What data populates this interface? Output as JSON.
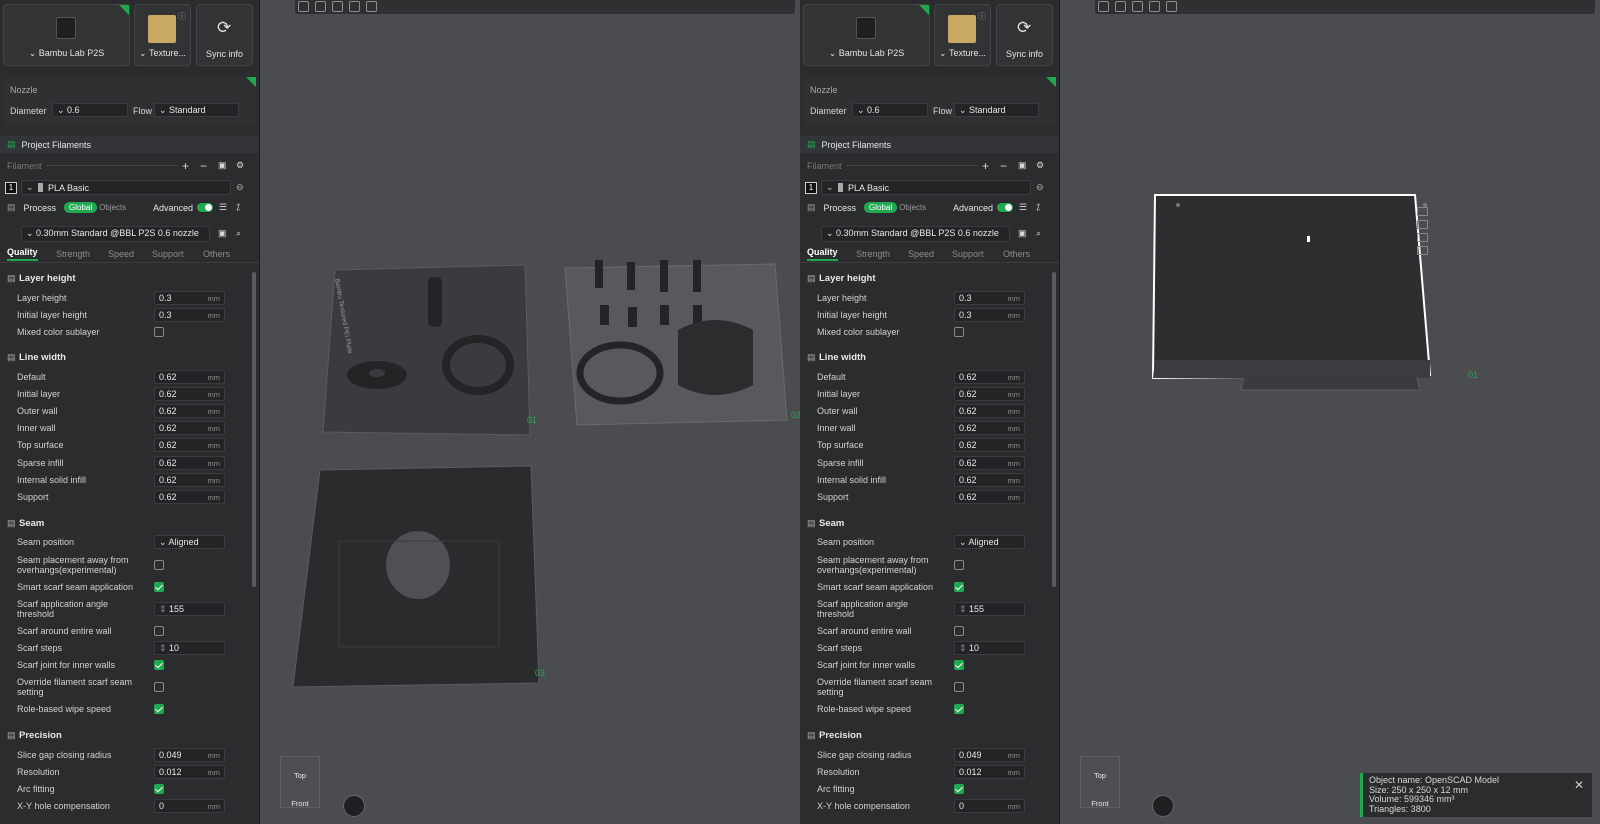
{
  "printer": {
    "name": "Bambu Lab P2S",
    "plate": "Texture...",
    "sync": "Sync info"
  },
  "nozzle": {
    "title": "Nozzle",
    "diameter_label": "Diameter",
    "diameter_value": "0.6",
    "flow_label": "Flow",
    "flow_value": "Standard"
  },
  "filaments": {
    "title": "Project Filaments",
    "filament_label": "Filament",
    "slot": "1",
    "material": "PLA Basic"
  },
  "process": {
    "title": "Process",
    "global": "Global",
    "objects": "Objects",
    "advanced": "Advanced",
    "preset": "0.30mm Standard @BBL P2S 0.6 nozzle"
  },
  "tabs": [
    "Quality",
    "Strength",
    "Speed",
    "Support",
    "Others"
  ],
  "sections": {
    "layer_height": {
      "title": "Layer height",
      "layer_height_label": "Layer height",
      "layer_height": "0.3",
      "initial_label": "Initial layer height",
      "initial": "0.3",
      "mixed_label": "Mixed color sublayer"
    },
    "line_width": {
      "title": "Line width",
      "rows": [
        [
          "Default",
          "0.62"
        ],
        [
          "Initial layer",
          "0.62"
        ],
        [
          "Outer wall",
          "0.62"
        ],
        [
          "Inner wall",
          "0.62"
        ],
        [
          "Top surface",
          "0.62"
        ],
        [
          "Sparse infill",
          "0.62"
        ],
        [
          "Internal solid infill",
          "0.62"
        ],
        [
          "Support",
          "0.62"
        ]
      ]
    },
    "seam": {
      "title": "Seam",
      "position_label": "Seam position",
      "position": "Aligned",
      "away_label": "Seam placement away from overhangs(experimental)",
      "smart_label": "Smart scarf seam application",
      "angle_label": "Scarf application angle threshold",
      "angle": "155",
      "around_label": "Scarf around entire wall",
      "steps_label": "Scarf steps",
      "steps": "10",
      "inner_label": "Scarf joint for inner walls",
      "override_label": "Override filament scarf seam setting",
      "wipe_label": "Role-based wipe speed"
    },
    "precision": {
      "title": "Precision",
      "gap_label": "Slice gap closing radius",
      "gap": "0.049",
      "res_label": "Resolution",
      "res": "0.012",
      "arc_label": "Arc fitting",
      "xy_label": "X-Y hole compensation",
      "xy": "0"
    }
  },
  "unit_mm": "mm",
  "viewport": {
    "plate_label": "Bambu Textured PEI Plate",
    "ids": [
      "01",
      "02",
      "03"
    ],
    "cube_top": "Top",
    "cube_front": "Front",
    "right_id": "01"
  },
  "object_info": {
    "name": "Object name: OpenSCAD Model",
    "size": "Size: 250 x 250 x 12 mm",
    "volume": "Volume: 599346 mm³",
    "triangles": "Triangles: 3800"
  },
  "colors": {
    "accent": "#21a952",
    "panel": "#2b2c2e",
    "viewport": "#4b4c4f"
  }
}
